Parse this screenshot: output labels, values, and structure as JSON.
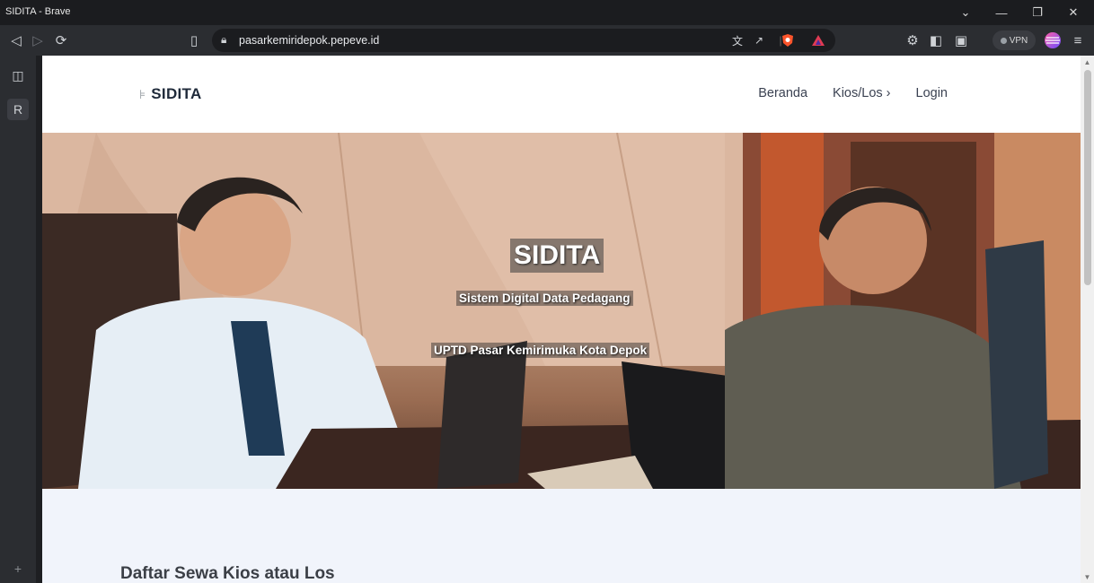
{
  "window": {
    "title": "SIDITA - Brave"
  },
  "toolbar": {
    "url": "pasarkemiridepok.pepeve.id",
    "vpn_label": "VPN"
  },
  "site": {
    "brand": "SIDITA",
    "nav": [
      {
        "label": "Beranda"
      },
      {
        "label": "Kios/Los ›"
      },
      {
        "label": "Login"
      }
    ]
  },
  "hero": {
    "title": "SIDITA",
    "subtitle": "Sistem Digital Data Pedagang",
    "organization": "UPTD Pasar Kemirimuka Kota Depok"
  },
  "section": {
    "title": "Daftar Sewa Kios atau Los"
  },
  "colors": {
    "brand_text": "#1f2a3a",
    "page_bg": "#f1f4fb"
  }
}
